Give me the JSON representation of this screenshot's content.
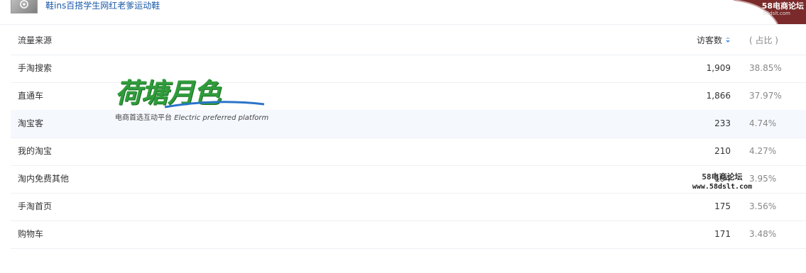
{
  "header": {
    "product_title": "鞋ins百搭学生网红老爹运动鞋",
    "corner_badge": "58电商论坛",
    "corner_badge_sub": "58dslt.com"
  },
  "table": {
    "columns": {
      "source": "流量来源",
      "visitors": "访客数",
      "share": "( 占比 )"
    },
    "rows": [
      {
        "source": "手淘搜索",
        "visitors": "1,909",
        "share": "38.85%"
      },
      {
        "source": "直通车",
        "visitors": "1,866",
        "share": "37.97%"
      },
      {
        "source": "淘宝客",
        "visitors": "233",
        "share": "4.74%"
      },
      {
        "source": "我的淘宝",
        "visitors": "210",
        "share": "4.27%"
      },
      {
        "source": "淘内免费其他",
        "visitors": "194",
        "share": "3.95%"
      },
      {
        "source": "手淘首页",
        "visitors": "175",
        "share": "3.56%"
      },
      {
        "source": "购物车",
        "visitors": "171",
        "share": "3.48%"
      }
    ]
  },
  "watermarks": {
    "logo_title": "荷塘月色",
    "logo_sub_cn": "电商首选互动平台",
    "logo_sub_en": "Electric preferred platform",
    "site_cn": "58电商论坛",
    "site_url": "www.58dslt.com"
  },
  "colors": {
    "link": "#1a5aa8",
    "highlight_row": "#f5f8fd",
    "sort_icon": "#4a90e2",
    "logo_green": "#2f9c3b",
    "logo_blue": "#2a74c9"
  },
  "icons": {
    "sort": "sort-icon",
    "product_thumb": "product-thumbnail"
  }
}
